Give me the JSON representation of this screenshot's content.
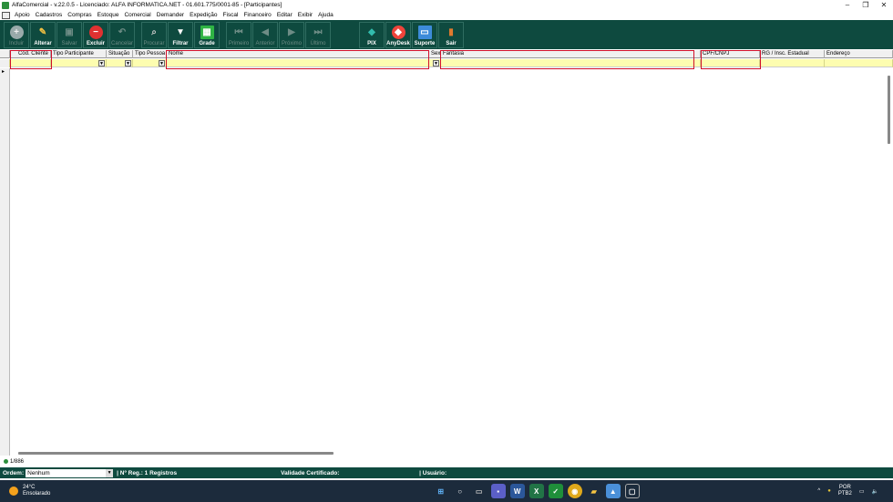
{
  "window": {
    "title": "AlfaComercial - v.22.0.5 - Licenciado: ALFA INFORMATICA.NET - 01.601.775/0001-85 - [Participantes]",
    "minimize": "–",
    "maximize": "❐",
    "close": "✕"
  },
  "menu": [
    "Apoio",
    "Cadastros",
    "Compras",
    "Estoque",
    "Comercial",
    "Demander",
    "Expedição",
    "Fiscal",
    "Financeiro",
    "Editar",
    "Exibir",
    "Ajuda"
  ],
  "toolbar": {
    "incluir": "Incluir",
    "alterar": "Alterar",
    "salvar": "Salvar",
    "excluir": "Excluir",
    "cancelar": "Cancelar",
    "procurar": "Procurar",
    "filtrar": "Filtrar",
    "grade": "Grade",
    "primeiro": "Primeiro",
    "anterior": "Anterior",
    "proximo": "Próximo",
    "ultimo": "Último",
    "pix": "PIX",
    "anydesk": "AnyDesk",
    "suporte": "Suporte",
    "sair": "Sair"
  },
  "grid": {
    "columns": [
      "Cód. Cliente",
      "Tipo Participante",
      "Situação",
      "Tipo Pessoa",
      "Nome",
      "Sexo",
      "Fantasia",
      "CPF/CNPJ",
      "RG / Insc. Estadual",
      "Endereço"
    ],
    "row_indicator": "▸"
  },
  "record_counter": "1/886",
  "status": {
    "ordem_label": "Ordem:",
    "ordem_value": "Nenhum",
    "nreg": "| Nº Reg.: 1 Registros",
    "validade": "Validade Certificado:",
    "usuario": "| Usuário:"
  },
  "taskbar": {
    "temp": "24°C",
    "weather": "Ensolarado",
    "lang1": "POR",
    "lang2": "PTB2",
    "chevron": "^"
  },
  "colors": {
    "toolbar_bg": "#0e4a3f",
    "filter_row": "#fdfdb0",
    "highlight": "#d0102a"
  }
}
